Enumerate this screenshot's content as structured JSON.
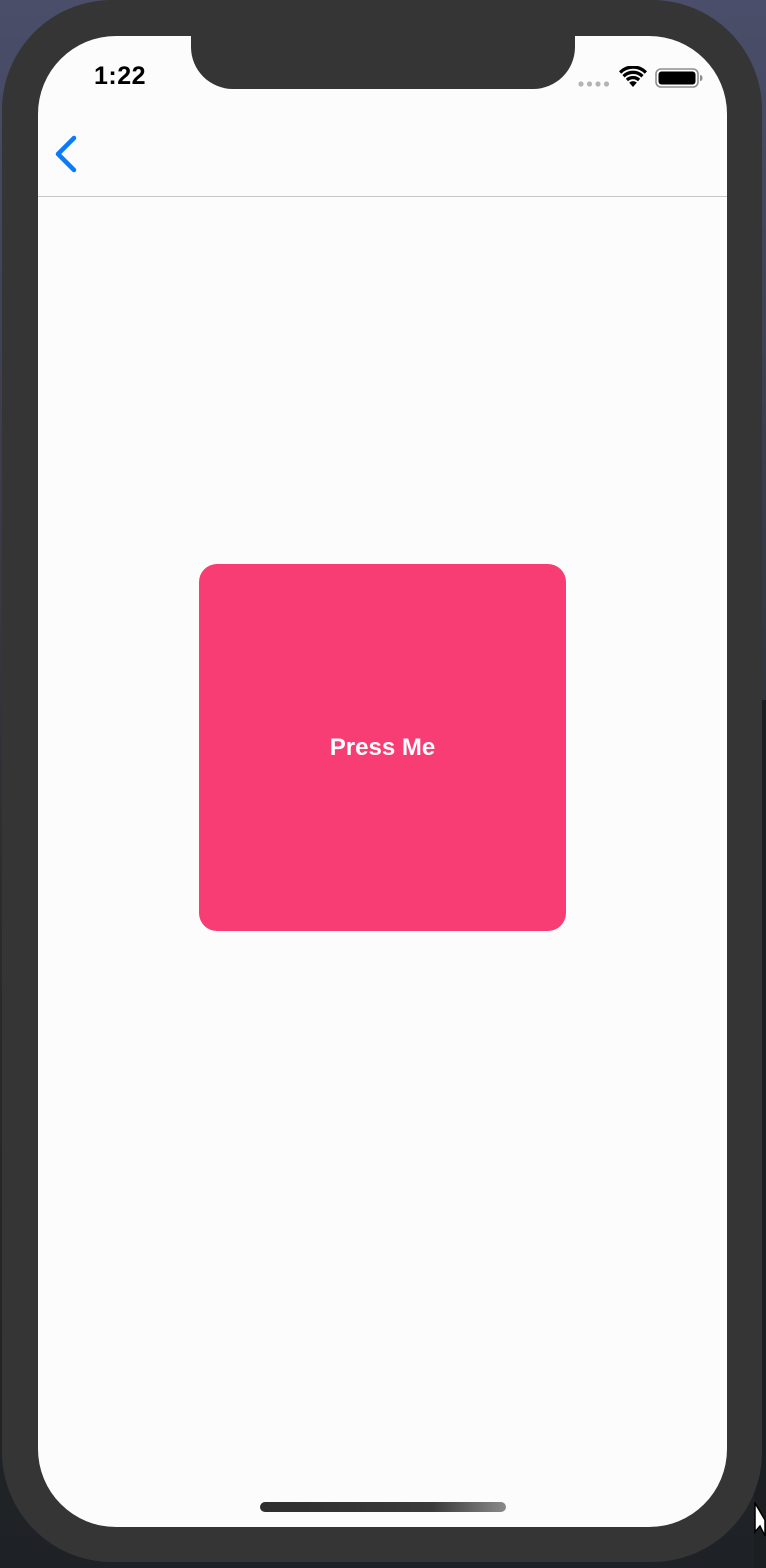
{
  "status_bar": {
    "time": "1:22",
    "icons": [
      "cellular-signal-icon",
      "wifi-icon",
      "battery-icon"
    ]
  },
  "navigation": {
    "back_icon": "chevron-left-icon",
    "accent_color": "#0a7aff"
  },
  "main": {
    "button_label": "Press Me",
    "button_color": "#f73d74"
  }
}
